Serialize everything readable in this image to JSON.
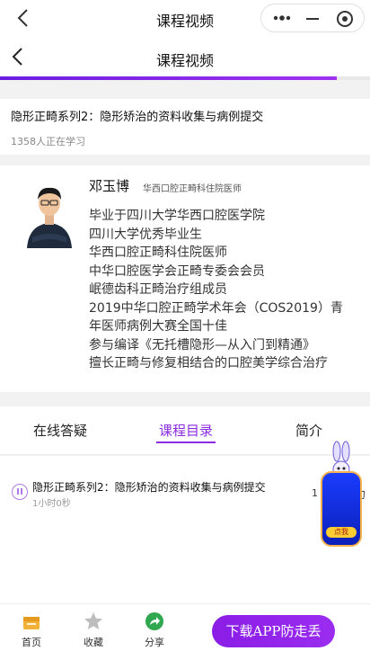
{
  "window": {
    "title": "课程视频"
  },
  "header": {
    "title": "课程视频",
    "progress": 0.91
  },
  "course": {
    "title": "隐形正畸系列2：隐形矫治的资料收集与病例提交",
    "learners": "1358人正在学习"
  },
  "teacher": {
    "name": "邓玉博",
    "title": "华西口腔正畸科住院医师",
    "bio": [
      "毕业于四川大学华西口腔医学院",
      "四川大学优秀毕业生",
      "华西口腔正畸科住院医师",
      "中华口腔医学会正畸专委会会员",
      "岷德齿科正畸治疗组成员",
      "2019中华口腔正畸学术年会（COS2019）青",
      "年医师病例大赛全国十佳",
      "参与编译《无托槽隐形—从入门到精通》",
      "擅长正畸与修复相结合的口腔美学综合治疗"
    ]
  },
  "tabs": [
    {
      "label": "在线答疑"
    },
    {
      "label": "课程目录"
    },
    {
      "label": "简介"
    }
  ],
  "lessons": [
    {
      "title": "隐形正畸系列2：隐形矫治的资料收集与病例提交",
      "duration": "1小时0秒",
      "side_a": "1",
      "side_b": "刀"
    }
  ],
  "float_widget": {
    "label": "点我"
  },
  "bottom_nav": {
    "items": [
      {
        "label": "首页"
      },
      {
        "label": "收藏"
      },
      {
        "label": "分享"
      }
    ],
    "download_label": "下载APP防走丢"
  },
  "colors": {
    "accent": "#8b2be2",
    "progress_bg": "#e8e8e8"
  },
  "icons": {
    "home": "home-icon",
    "favorite": "star-icon",
    "share": "share-icon"
  }
}
